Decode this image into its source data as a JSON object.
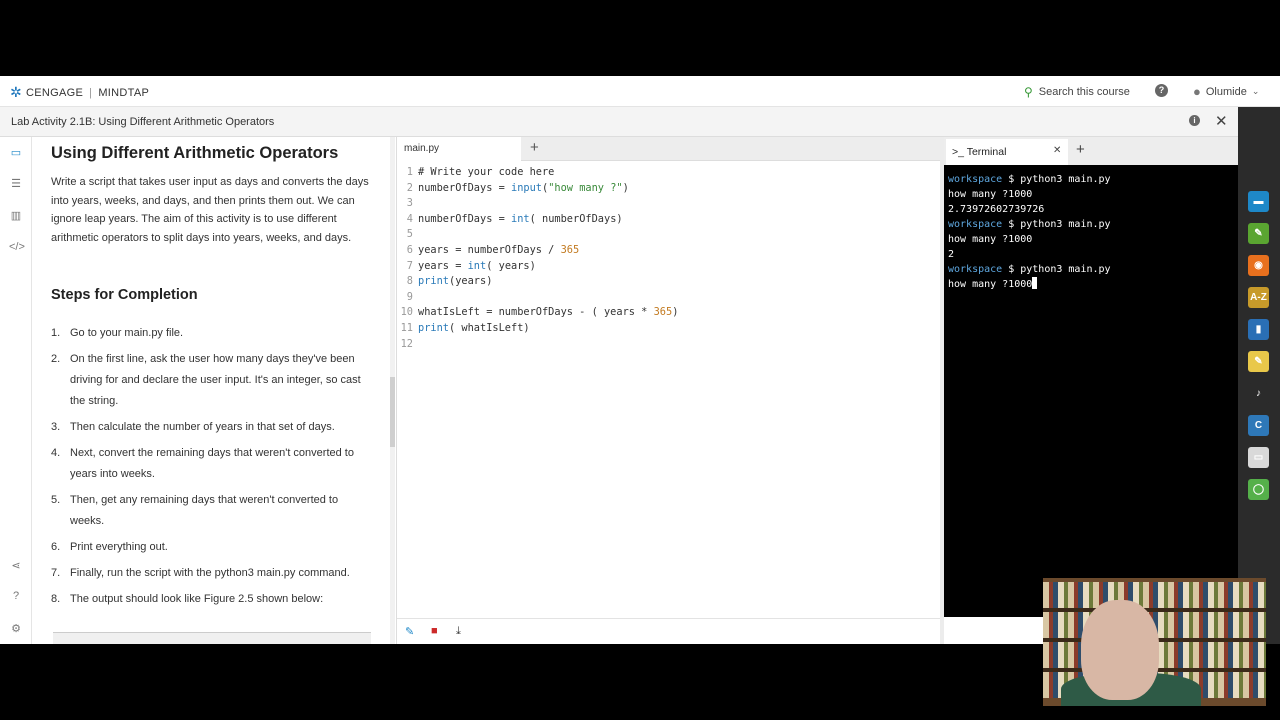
{
  "header": {
    "brand": "CENGAGE",
    "product": "MINDTAP",
    "search_label": "Search this course",
    "user_name": "Olumide"
  },
  "activity_title": "Lab Activity 2.1B: Using Different Arithmetic Operators",
  "reading": {
    "title": "Using Different Arithmetic Operators",
    "intro": "Write a script that takes user input as days and converts the days into years, weeks, and days, and then prints them out. We can ignore leap years. The aim of this activity is to use different arithmetic operators to split days into years, weeks, and days.",
    "steps_heading": "Steps for Completion",
    "steps": [
      {
        "num": "1.",
        "text": "Go to your main.py file."
      },
      {
        "num": "2.",
        "text": "On the first line, ask the user how many days they've been driving for and declare the user input. It's an integer, so cast the string."
      },
      {
        "num": "3.",
        "text": "Then calculate the number of years in that set of days."
      },
      {
        "num": "4.",
        "text": "Next, convert the remaining days that weren't converted to years into weeks."
      },
      {
        "num": "5.",
        "text": "Then, get any remaining days that weren't converted to weeks."
      },
      {
        "num": "6.",
        "text": "Print everything out."
      },
      {
        "num": "7.",
        "text": "Finally, run the script with the python3 main.py command."
      },
      {
        "num": "8.",
        "text": "The output should look like Figure 2.5 shown below:"
      }
    ]
  },
  "editor": {
    "tab_label": "main.py",
    "lines": [
      {
        "no": "1",
        "text": "# Write your code here"
      },
      {
        "no": "2",
        "text": "numberOfDays = input(\"how many ?\")"
      },
      {
        "no": "3",
        "text": ""
      },
      {
        "no": "4",
        "text": "numberOfDays = int( numberOfDays)"
      },
      {
        "no": "5",
        "text": ""
      },
      {
        "no": "6",
        "text": "years = numberOfDays / 365"
      },
      {
        "no": "7",
        "text": "years = int( years)"
      },
      {
        "no": "8",
        "text": "print(years)"
      },
      {
        "no": "9",
        "text": ""
      },
      {
        "no": "10",
        "text": "whatIsLeft = numberOfDays - ( years * 365)"
      },
      {
        "no": "11",
        "text": "print( whatIsLeft)"
      },
      {
        "no": "12",
        "text": ""
      }
    ]
  },
  "terminal": {
    "tab_label": "Terminal",
    "prompt_symbol": ">_",
    "lines": [
      {
        "prompt": "workspace",
        "text": " $ python3 main.py"
      },
      {
        "prompt": "",
        "text": "how many ?1000"
      },
      {
        "prompt": "",
        "text": "2.73972602739726"
      },
      {
        "prompt": "workspace",
        "text": " $ python3 main.py"
      },
      {
        "prompt": "",
        "text": "how many ?1000"
      },
      {
        "prompt": "",
        "text": "2"
      },
      {
        "prompt": "workspace",
        "text": " $ python3 main.py"
      },
      {
        "prompt": "",
        "text": "how many ?1000"
      }
    ]
  },
  "tools": [
    {
      "icon": "briefcase-icon",
      "color": "#1e88c8",
      "glyph": "▬"
    },
    {
      "icon": "pencil-icon",
      "color": "#5aa531",
      "glyph": "✎"
    },
    {
      "icon": "rss-icon",
      "color": "#e8701e",
      "glyph": "◉"
    },
    {
      "icon": "dictionary-icon",
      "color": "#c79a2a",
      "glyph": "A-Z"
    },
    {
      "icon": "book-icon",
      "color": "#2a6fb5",
      "glyph": "▮"
    },
    {
      "icon": "notes-icon",
      "color": "#e9c84a",
      "glyph": "✎"
    },
    {
      "icon": "audio-icon",
      "color": "#2b2b2b",
      "glyph": "♪"
    },
    {
      "icon": "cnow-icon",
      "color": "#2e78b8",
      "glyph": "C"
    },
    {
      "icon": "flashcards-icon",
      "color": "#d9d9d9",
      "glyph": "▭"
    },
    {
      "icon": "circle-app-icon",
      "color": "#55b04a",
      "glyph": "◯"
    }
  ]
}
